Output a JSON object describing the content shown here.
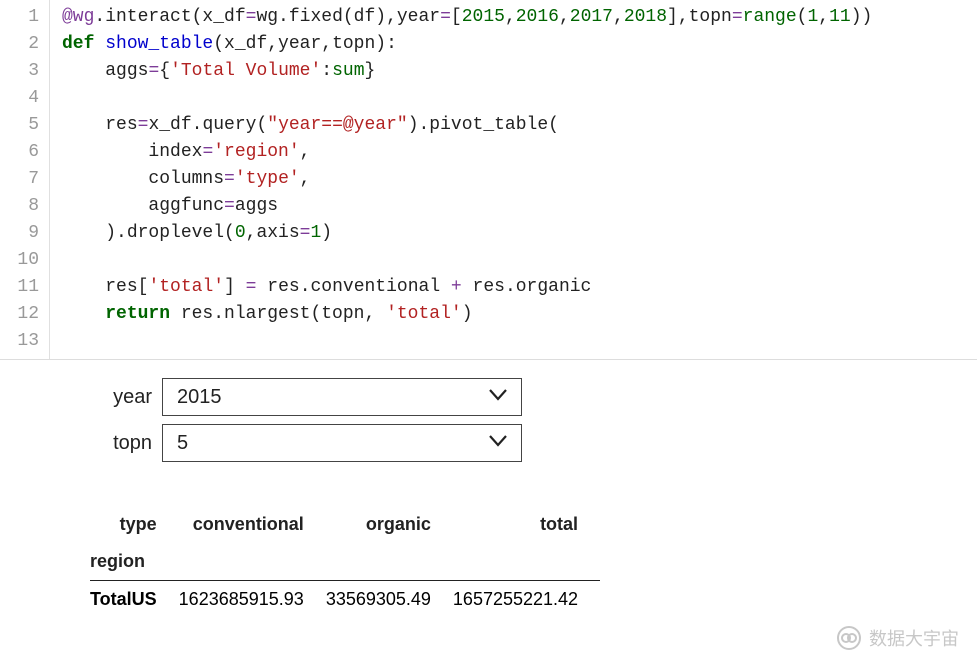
{
  "code": {
    "lines": [
      {
        "n": "1",
        "html": "<span class='tok-dec'>@wg</span><span class='tok-plain'>.interact(x_df</span><span class='tok-op'>=</span><span class='tok-plain'>wg.fixed(df),year</span><span class='tok-op'>=</span><span class='tok-plain'>[</span><span class='tok-num'>2015</span><span class='tok-plain'>,</span><span class='tok-num'>2016</span><span class='tok-plain'>,</span><span class='tok-num'>2017</span><span class='tok-plain'>,</span><span class='tok-num'>2018</span><span class='tok-plain'>],topn</span><span class='tok-op'>=</span><span class='tok-builtin'>range</span><span class='tok-plain'>(</span><span class='tok-num'>1</span><span class='tok-plain'>,</span><span class='tok-num'>11</span><span class='tok-plain'>))</span>"
      },
      {
        "n": "2",
        "html": "<span class='tok-kw'>def</span> <span class='tok-fn'>show_table</span><span class='tok-plain'>(x_df,year,topn):</span>"
      },
      {
        "n": "3",
        "html": "    <span class='tok-plain'>aggs</span><span class='tok-op'>=</span><span class='tok-plain'>{</span><span class='tok-str'>'Total Volume'</span><span class='tok-plain'>:</span><span class='tok-builtin'>sum</span><span class='tok-plain'>}</span>"
      },
      {
        "n": "4",
        "html": ""
      },
      {
        "n": "5",
        "html": "    <span class='tok-plain'>res</span><span class='tok-op'>=</span><span class='tok-plain'>x_df.query(</span><span class='tok-str'>\"year==@year\"</span><span class='tok-plain'>).pivot_table(</span>"
      },
      {
        "n": "6",
        "html": "        <span class='tok-plain'>index</span><span class='tok-op'>=</span><span class='tok-str'>'region'</span><span class='tok-plain'>,</span>"
      },
      {
        "n": "7",
        "html": "        <span class='tok-plain'>columns</span><span class='tok-op'>=</span><span class='tok-str'>'type'</span><span class='tok-plain'>,</span>"
      },
      {
        "n": "8",
        "html": "        <span class='tok-plain'>aggfunc</span><span class='tok-op'>=</span><span class='tok-plain'>aggs</span>"
      },
      {
        "n": "9",
        "html": "    <span class='tok-plain'>).droplevel(</span><span class='tok-num'>0</span><span class='tok-plain'>,axis</span><span class='tok-op'>=</span><span class='tok-num'>1</span><span class='tok-plain'>)</span>"
      },
      {
        "n": "10",
        "html": ""
      },
      {
        "n": "11",
        "html": "    <span class='tok-plain'>res[</span><span class='tok-str'>'total'</span><span class='tok-plain'>] </span><span class='tok-op'>=</span><span class='tok-plain'> res.conventional </span><span class='tok-op'>+</span><span class='tok-plain'> res.organic</span>"
      },
      {
        "n": "12",
        "html": "    <span class='tok-kw'>return</span><span class='tok-plain'> res.nlargest(topn, </span><span class='tok-str'>'total'</span><span class='tok-plain'>)</span>"
      },
      {
        "n": "13",
        "html": ""
      }
    ]
  },
  "widgets": {
    "year": {
      "label": "year",
      "value": "2015"
    },
    "topn": {
      "label": "topn",
      "value": "5"
    }
  },
  "table": {
    "type_label": "type",
    "region_label": "region",
    "columns": [
      "conventional",
      "organic",
      "total"
    ],
    "rows": [
      {
        "label": "TotalUS",
        "values": [
          "1623685915.93",
          "33569305.49",
          "1657255221.42"
        ]
      }
    ]
  },
  "watermark": "数据大宇宙"
}
